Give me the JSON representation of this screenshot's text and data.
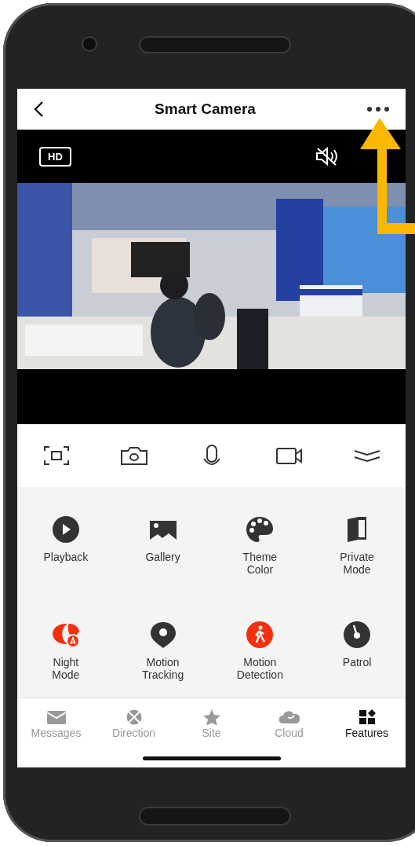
{
  "header": {
    "title": "Smart Camera"
  },
  "player": {
    "quality": "HD",
    "muted": true
  },
  "toolbar": [
    {
      "kind": "fullscreen"
    },
    {
      "kind": "snapshot"
    },
    {
      "kind": "mic"
    },
    {
      "kind": "record"
    },
    {
      "kind": "collapse"
    }
  ],
  "features": [
    {
      "label": "Playback",
      "kind": "playback",
      "on": false
    },
    {
      "label": "Gallery",
      "kind": "gallery",
      "on": false
    },
    {
      "label": "Theme\nColor",
      "kind": "theme",
      "on": false
    },
    {
      "label": "Private\nMode",
      "kind": "private",
      "on": false
    },
    {
      "label": "Night\nMode",
      "kind": "night",
      "on": true
    },
    {
      "label": "Motion\nTracking",
      "kind": "tracking",
      "on": false
    },
    {
      "label": "Motion\nDetection",
      "kind": "detection",
      "on": true
    },
    {
      "label": "Patrol",
      "kind": "patrol",
      "on": false
    }
  ],
  "tabs": [
    {
      "label": "Messages",
      "kind": "messages",
      "selected": false
    },
    {
      "label": "Direction",
      "kind": "direction",
      "selected": false
    },
    {
      "label": "Site",
      "kind": "site",
      "selected": false
    },
    {
      "label": "Cloud",
      "kind": "cloud",
      "selected": false
    },
    {
      "label": "Features",
      "kind": "features",
      "selected": true
    }
  ]
}
